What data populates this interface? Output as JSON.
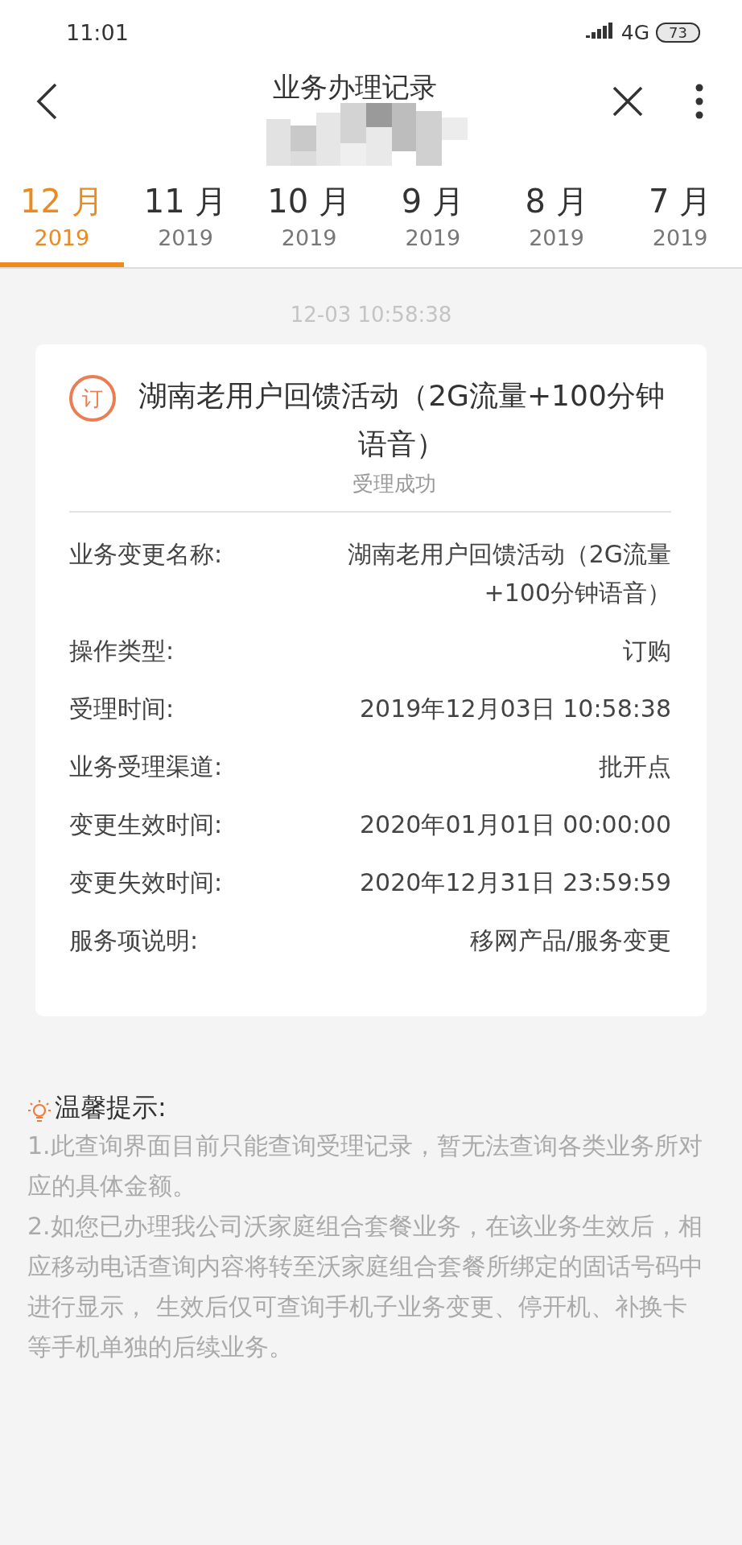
{
  "status_bar": {
    "time": "11:01",
    "network": "4G",
    "battery": "73"
  },
  "header": {
    "title": "业务办理记录"
  },
  "tabs": [
    {
      "month": "12 月",
      "year": "2019",
      "selected": true
    },
    {
      "month": "11 月",
      "year": "2019",
      "selected": false
    },
    {
      "month": "10 月",
      "year": "2019",
      "selected": false
    },
    {
      "month": "9 月",
      "year": "2019",
      "selected": false
    },
    {
      "month": "8 月",
      "year": "2019",
      "selected": false
    },
    {
      "month": "7 月",
      "year": "2019",
      "selected": false
    }
  ],
  "record": {
    "timestamp": "12-03 10:58:38",
    "badge": "订",
    "title": "湖南老用户回馈活动（2G流量+100分钟语音）",
    "status": "受理成功",
    "fields": [
      {
        "label": "业务变更名称:",
        "value": "湖南老用户回馈活动（2G流量+100分钟语音）"
      },
      {
        "label": "操作类型:",
        "value": "订购"
      },
      {
        "label": "受理时间:",
        "value": "2019年12月03日 10:58:38"
      },
      {
        "label": "业务受理渠道:",
        "value": "批开点"
      },
      {
        "label": "变更生效时间:",
        "value": "2020年01月01日 00:00:00"
      },
      {
        "label": "变更失效时间:",
        "value": "2020年12月31日 23:59:59"
      },
      {
        "label": "服务项说明:",
        "value": "移网产品/服务变更"
      }
    ]
  },
  "tips": {
    "title": "温馨提示:",
    "lines": [
      "1.此查询界面目前只能查询受理记录，暂无法查询各类业务所对应的具体金额。",
      "2.如您已办理我公司沃家庭组合套餐业务，在该业务生效后，相应移动电话查询内容将转至沃家庭组合套餐所绑定的固话号码中进行显示， 生效后仅可查询手机子业务变更、停开机、补换卡等手机单独的后续业务。"
    ]
  }
}
